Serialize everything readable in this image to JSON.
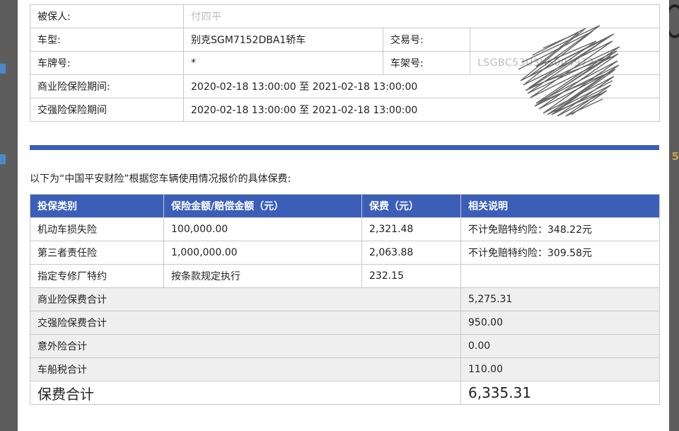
{
  "side_text": "5",
  "policy_info": {
    "insured_label": "被保人:",
    "insured_value": "付四平",
    "model_label": "车型:",
    "model_value": "别克SGM7152DBA1轿车",
    "trade_label": "交易号:",
    "trade_value": "",
    "plate_label": "车牌号:",
    "plate_value": "*",
    "vin_label": "车架号:",
    "vin_value": "LSGBC53U3HS004972",
    "commercial_label": "商业险保险期间:",
    "commercial_value": "2020-02-18 13:00:00 至 2021-02-18 13:00:00",
    "compulsory_label": "交强险保险期间",
    "compulsory_value": "2020-02-18 13:00:00 至 2021-02-18 13:00:00"
  },
  "intro_text": "以下为“中国平安财险”根据您车辆使用情况报价的具体保费:",
  "fee_table": {
    "headers": [
      "投保类别",
      "保险金额/赔偿金额（元）",
      "保费（元）",
      "相关说明"
    ],
    "rows": [
      [
        "机动车损失险",
        "100,000.00",
        "2,321.48",
        "不计免赔特约险：348.22元"
      ],
      [
        "第三者责任险",
        "1,000,000.00",
        "2,063.88",
        "不计免赔特约险：309.58元"
      ],
      [
        "指定专修厂特约",
        "按条款规定执行",
        "232.15",
        ""
      ]
    ],
    "sums": [
      [
        "商业险保费合计",
        "5,275.31"
      ],
      [
        "交强险保费合计",
        "950.00"
      ],
      [
        "意外险合计",
        "0.00"
      ],
      [
        "车船税合计",
        "110.00"
      ]
    ],
    "total_label": "保费合计",
    "total_value": "6,335.31"
  }
}
